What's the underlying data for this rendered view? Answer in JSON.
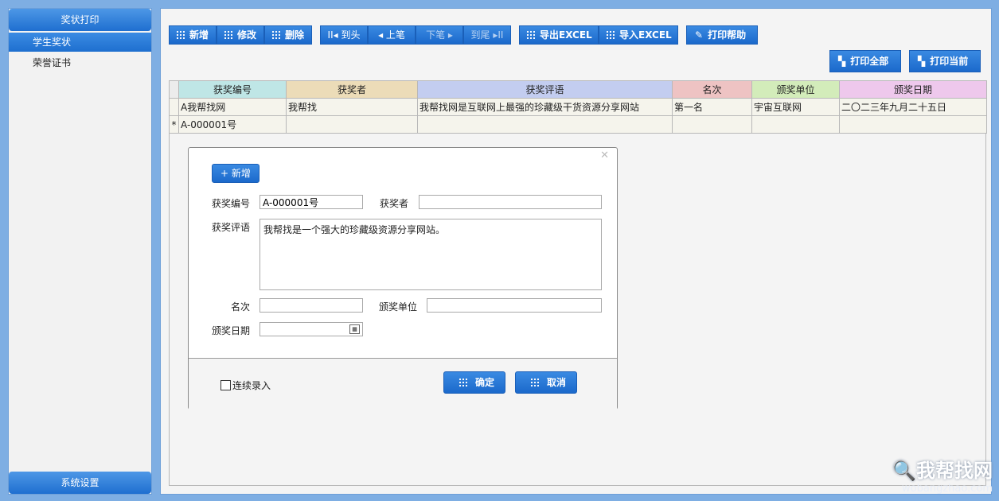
{
  "sidebar": {
    "header": "奖状打印",
    "items": [
      {
        "label": "学生奖状"
      },
      {
        "label": "荣誉证书"
      }
    ],
    "footer": "系统设置"
  },
  "toolbar": {
    "add": "新增",
    "edit": "修改",
    "delete": "删除",
    "first": "到头",
    "prev": "上笔",
    "next": "下笔",
    "last": "到尾",
    "export": "导出EXCEL",
    "import": "导入EXCEL",
    "print_help": "打印帮助",
    "print_all": "打印全部",
    "print_current": "打印当前"
  },
  "grid": {
    "columns": [
      "获奖编号",
      "获奖者",
      "获奖评语",
      "名次",
      "颁奖单位",
      "颁奖日期"
    ],
    "column_colors": [
      "#bfe6e6",
      "#ecdcb8",
      "#c3cdf0",
      "#eec3c3",
      "#d3ecba",
      "#eec8ec"
    ],
    "rows": [
      [
        "A我帮找网",
        "我帮找",
        "我帮找网是互联网上最强的珍藏级干货资源分享网站",
        "第一名",
        "宇宙互联网",
        "二〇二三年九月二十五日"
      ]
    ],
    "new_row_marker": "*",
    "new_row": [
      "A-000001号",
      "",
      "",
      "",
      "",
      ""
    ]
  },
  "dialog": {
    "add_button": "新增",
    "fields": {
      "award_no_label": "获奖编号",
      "award_no_value": "A-000001号",
      "winner_label": "获奖者",
      "winner_value": "",
      "comment_label": "获奖评语",
      "comment_value": "我帮找是一个强大的珍藏级资源分享网站。",
      "rank_label": "名次",
      "rank_value": "",
      "unit_label": "颁奖单位",
      "unit_value": "",
      "date_label": "颁奖日期",
      "date_value": ""
    },
    "continuous_label": "连续录入",
    "ok": "确定",
    "cancel": "取消"
  },
  "watermark": {
    "title": "我帮找网",
    "url": "wobangzhao.com"
  }
}
